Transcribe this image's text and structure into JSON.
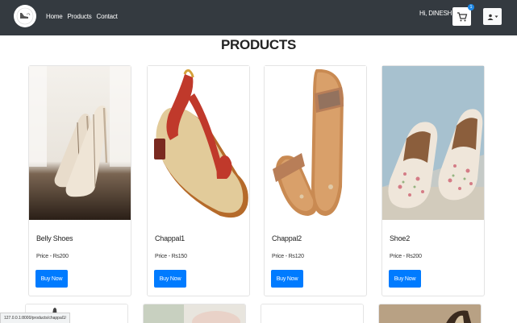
{
  "navbar": {
    "links": [
      "Home",
      "Products",
      "Contact"
    ],
    "greeting": "Hi, DINESH",
    "cart_count": "1"
  },
  "page": {
    "title": "PRODUCTS"
  },
  "products": [
    {
      "name": "Belly Shoes",
      "price": "Price - Rs200",
      "button": "Buy Now",
      "image": "belly-shoes"
    },
    {
      "name": "Chappal1",
      "price": "Price - Rs150",
      "button": "Buy Now",
      "image": "chappal1"
    },
    {
      "name": "Chappal2",
      "price": "Price - Rs120",
      "button": "Buy Now",
      "image": "chappal2"
    },
    {
      "name": "Shoe2",
      "price": "Price - Rs200",
      "button": "Buy Now",
      "image": "shoe2"
    }
  ],
  "status_bar": {
    "url": "127.0.0.1:8000/products/chappal1/"
  },
  "colors": {
    "navbar": "#343a40",
    "button": "#007bff",
    "badge": "#1e88e5"
  }
}
